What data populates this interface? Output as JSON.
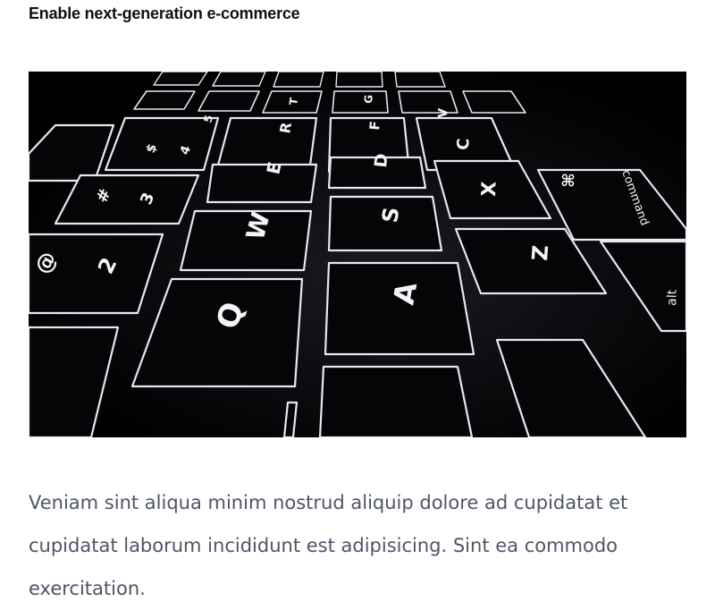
{
  "article": {
    "heading": "Enable next-generation e-commerce",
    "body": "Veniam sint aliqua minim nostrud aliquip dolore ad cupidatat et cupidatat laborum incididunt est adipisicing. Sint ea commodo exercitation."
  },
  "photo": {
    "subject": "backlit-keyboard",
    "keys": {
      "q": "Q",
      "w": "W",
      "e": "E",
      "r": "R",
      "t": "T",
      "a": "A",
      "s": "S",
      "d": "D",
      "f": "F",
      "g": "G",
      "z": "Z",
      "x": "X",
      "c": "C",
      "v": "V",
      "at": "@",
      "two": "2",
      "hash": "#",
      "three": "3",
      "dollar": "$",
      "four": "4",
      "five": "5",
      "cmd": "⌘",
      "command": "command",
      "alt": "alt"
    }
  }
}
